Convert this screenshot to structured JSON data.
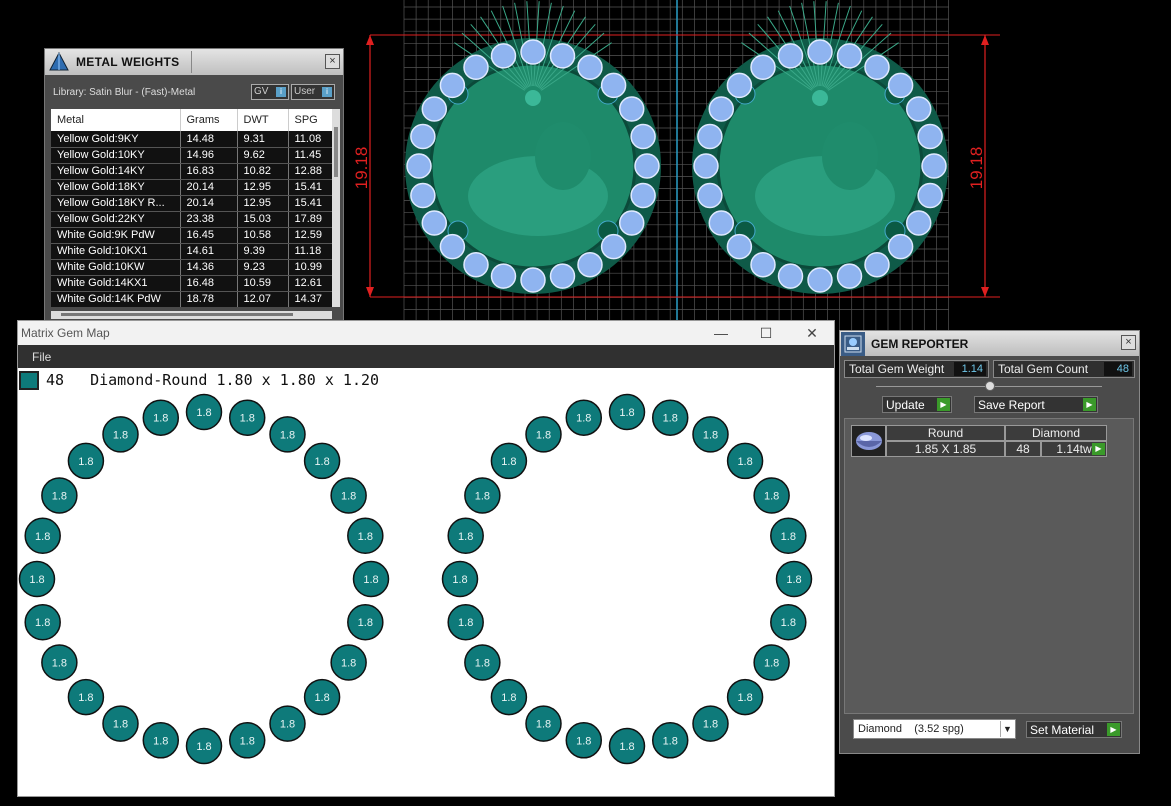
{
  "viewport": {
    "dimension_left": "19.18",
    "dimension_right": "19.18",
    "colors": {
      "grid": "#555555",
      "dim_line": "#e02020",
      "metal": "#1e8a6a",
      "gem": "#8fb4f0",
      "axis": "#2aa0c8"
    }
  },
  "metal_weights": {
    "title": "METAL WEIGHTS",
    "close_label": "×",
    "library_label": "Library: Satin Blur - (Fast)-Metal",
    "gv_label": "GV",
    "user_label": "User",
    "columns": [
      "Metal",
      "Grams",
      "DWT",
      "SPG"
    ],
    "rows": [
      [
        "Yellow Gold:9KY",
        "14.48",
        "9.31",
        "11.08"
      ],
      [
        "Yellow Gold:10KY",
        "14.96",
        "9.62",
        "11.45"
      ],
      [
        "Yellow Gold:14KY",
        "16.83",
        "10.82",
        "12.88"
      ],
      [
        "Yellow Gold:18KY",
        "20.14",
        "12.95",
        "15.41"
      ],
      [
        "Yellow Gold:18KY R...",
        "20.14",
        "12.95",
        "15.41"
      ],
      [
        "Yellow Gold:22KY",
        "23.38",
        "15.03",
        "17.89"
      ],
      [
        "White Gold:9K PdW",
        "16.45",
        "10.58",
        "12.59"
      ],
      [
        "White Gold:10KX1",
        "14.61",
        "9.39",
        "11.18"
      ],
      [
        "White Gold:10KW",
        "14.36",
        "9.23",
        "10.99"
      ],
      [
        "White Gold:14KX1",
        "16.48",
        "10.59",
        "12.61"
      ],
      [
        "White Gold:14K PdW",
        "18.78",
        "12.07",
        "14.37"
      ]
    ]
  },
  "gem_map": {
    "title": "Matrix Gem Map",
    "min_label": "—",
    "max_label": "☐",
    "close_label": "✕",
    "menu_file": "File",
    "count": "48",
    "description": "Diamond-Round 1.80 x 1.80 x 1.20",
    "gem_label": "1.8",
    "gems_per_ring": 24,
    "gem_color": "#0e7a7a"
  },
  "gem_reporter": {
    "title": "GEM REPORTER",
    "close_label": "×",
    "total_weight_label": "Total Gem Weight",
    "total_weight": "1.14",
    "total_count_label": "Total Gem Count",
    "total_count": "48",
    "update_label": "Update",
    "save_report_label": "Save Report",
    "row": {
      "shape": "Round",
      "size": "1.85 X 1.85",
      "type": "Diamond",
      "count": "48",
      "weight": "1.14tw"
    },
    "material_select": "Diamond    (3.52 spg)",
    "set_material_label": "Set Material"
  }
}
